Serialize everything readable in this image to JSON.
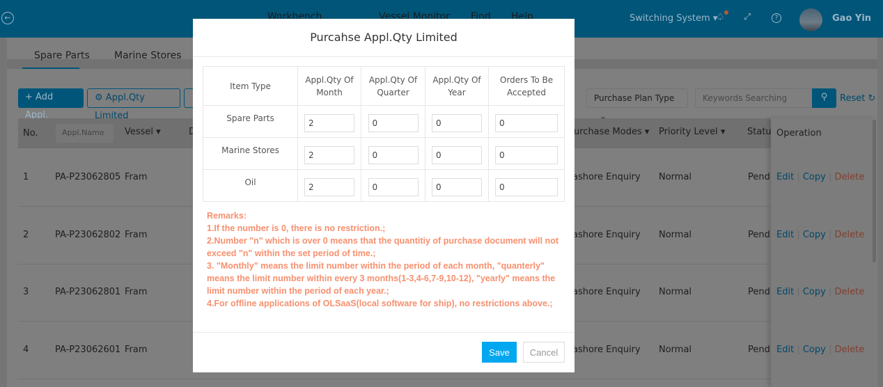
{
  "header": {
    "nav": [
      "Workbench",
      "Vessel Monitor",
      "Find",
      "Help"
    ],
    "switching_system": "Switching System",
    "user_name": "Gao Yin"
  },
  "tabs": [
    {
      "label": "Spare Parts",
      "active": true
    },
    {
      "label": "Marine Stores",
      "active": false
    }
  ],
  "toolbar": {
    "add": "+ Add Appl.",
    "qty_limited": "Appl.Qty Limited",
    "plan_type": "Purchase Plan Type",
    "search_placeholder": "Keywords Searching",
    "reset": "Reset"
  },
  "table": {
    "headers": {
      "no": "No.",
      "appl_name_placeholder": "Appl.Name",
      "vessel": "Vessel",
      "purchase_modes": "urchase Modes",
      "priority": "Priority Level",
      "status": "Status",
      "operation": "Operation"
    },
    "rows": [
      {
        "no": "1",
        "appl": "PA-P23062805",
        "vessel": "Fram",
        "mode": "ashore Enquiry",
        "priority": "Normal",
        "status": "Pendi"
      },
      {
        "no": "2",
        "appl": "PA-P23062802",
        "vessel": "Fram",
        "mode": "ashore Enquiry",
        "priority": "Normal",
        "status": "Pendi"
      },
      {
        "no": "3",
        "appl": "PA-P23062801",
        "vessel": "Fram",
        "mode": "ashore Enquiry",
        "priority": "Normal",
        "status": "Pendi"
      },
      {
        "no": "4",
        "appl": "PA-P23062601",
        "vessel": "Fram",
        "mode": "ashore Enquiry",
        "priority": "Normal",
        "status": "Pendi"
      }
    ],
    "actions": {
      "edit": "Edit",
      "copy": "Copy",
      "delete": "Delete"
    }
  },
  "modal": {
    "title": "Purcahse Appl.Qty Limited",
    "columns": [
      "Item Type",
      "Appl.Qty Of Month",
      "Appl.Qty Of Quarter",
      "Appl.Qty Of Year",
      "Orders To Be Accepted"
    ],
    "rows": [
      {
        "type": "Spare Parts",
        "values": [
          "2",
          "0",
          "0",
          "0"
        ]
      },
      {
        "type": "Marine Stores",
        "values": [
          "2",
          "0",
          "0",
          "0"
        ]
      },
      {
        "type": "Oil",
        "values": [
          "2",
          "0",
          "0",
          "0"
        ]
      }
    ],
    "remarks": [
      "Remarks:",
      "1.If the number is 0, there is no restriction.;",
      "2.Number \"n\" which is over 0 means that the quantitiy of purchase document will not exceed \"n\" within the set period of time.;",
      "3. \"Monthly\" means the limit number within the period of each month, \"quanterly\" means the limit number within every 3 months(1-3,4-6,7-9,10-12), \"yearly\" means the limit number within the period of each year.;",
      "4.For offline applications of OLSaaS(local software for ship), no restrictions above.;"
    ],
    "save": "Save",
    "cancel": "Cancel"
  },
  "colors": {
    "accent": "#02a7f0",
    "remarks": "#f7906f",
    "delete": "#c0604a"
  }
}
